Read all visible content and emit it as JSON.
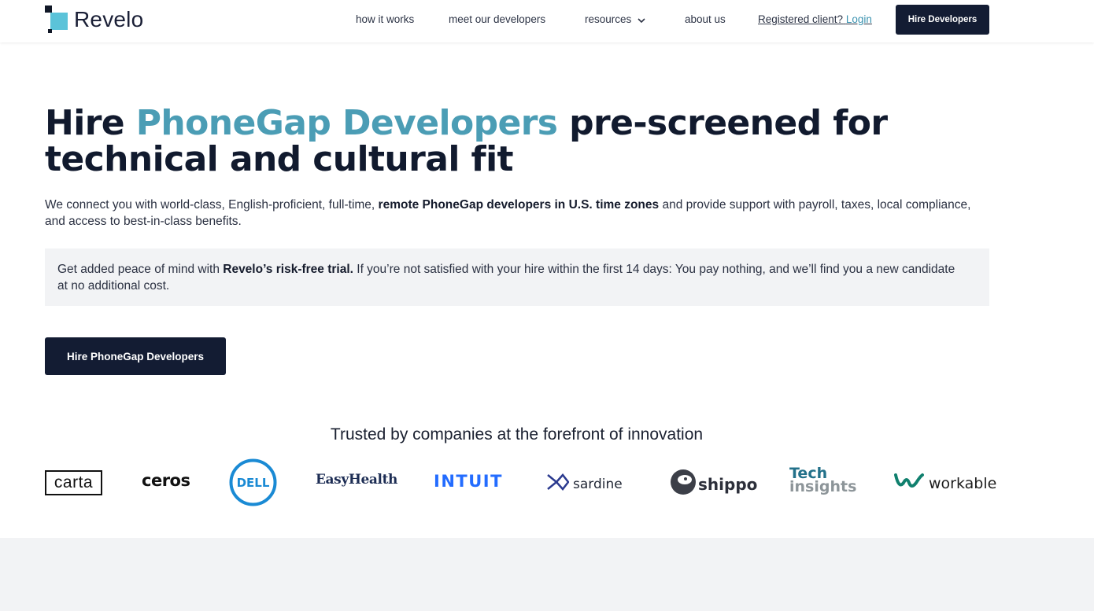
{
  "header": {
    "logo_text": "Revelo",
    "nav": {
      "how_it_works": "how it works",
      "meet_developers": "meet our developers",
      "resources": "resources",
      "about": "about us"
    },
    "login_prefix": "Registered client?",
    "login_link": "Login",
    "cta": "Hire Developers"
  },
  "hero": {
    "title_prefix": "Hire ",
    "title_accent": "PhoneGap Developers",
    "title_suffix": " pre-screened for technical and cultural fit",
    "sub_part1": "We connect you with world-class, English-proficient, full-time, ",
    "sub_bold": "remote PhoneGap developers in U.S. time zones",
    "sub_part2": " and provide support with payroll, taxes, local compliance, and access to best-in-class benefits.",
    "trial_part1": "Get added peace of mind with ",
    "trial_bold": "Revelo’s risk-free trial.",
    "trial_part2": " If you’re not satisfied with your hire within the first 14 days: You pay nothing, and we’ll find you a new candidate at no additional cost.",
    "cta": "Hire PhoneGap Developers"
  },
  "trusted": {
    "title": "Trusted by companies at the forefront of innovation",
    "logos": {
      "carta": "carta",
      "ceros": "ceros",
      "dell": "DELL",
      "easyhealth": "EasyHealth",
      "intuit": "INTUIT",
      "sardine": "sardine",
      "shippo": "shippo",
      "tech_line1": "Tech",
      "tech_line2": "insights",
      "workable": "workable"
    }
  },
  "colors": {
    "accent": "#4b9db5",
    "navy": "#131c33",
    "logo_square": "#5bc3d9",
    "panel_gray": "#f2f3f5"
  },
  "icons": [
    "revelo-logo-icon",
    "chevron-down-icon",
    "dell-logo-icon",
    "sardine-logo-icon",
    "shippo-logo-icon",
    "workable-logo-icon"
  ]
}
